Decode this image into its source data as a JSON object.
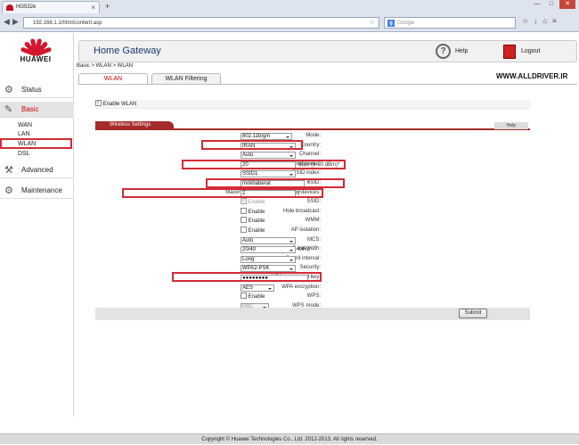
{
  "browser": {
    "tab_title": "HG532e",
    "tab_close": "×",
    "new_tab": "+",
    "url": "192.168.1.1/html/content.asp",
    "search_placeholder": "Google",
    "search_engine_letter": "g",
    "url_star": "☆",
    "back_arrow": "◀",
    "forward_arrow": "▶",
    "window_minimize": "—",
    "window_maximize": "□",
    "window_close": "✕"
  },
  "brand": {
    "logo_text": "HUAWEI"
  },
  "sidebar": {
    "items": [
      {
        "label": "Status",
        "icon": "status-icon"
      },
      {
        "label": "Basic",
        "icon": "wrench-icon",
        "active": true
      },
      {
        "label": "Advanced",
        "icon": "advanced-icon"
      },
      {
        "label": "Maintenance",
        "icon": "maintenance-icon"
      }
    ],
    "sub": [
      "WAN",
      "LAN",
      "WLAN",
      "DSL"
    ]
  },
  "header": {
    "title": "Home Gateway",
    "help": "Help",
    "logout": "Logout"
  },
  "breadcrumb": "Basic > WLAN > WLAN",
  "watermark": "WWW.ALLDRIVER.IR",
  "tabs": [
    {
      "label": "WLAN",
      "active": true
    },
    {
      "label": "WLAN Filtering",
      "active": false
    }
  ],
  "enable_wlan": {
    "label": "Enable WLAN",
    "checked": true
  },
  "section": {
    "title": "Wireless Settings",
    "help": "Help"
  },
  "fields": {
    "mode": {
      "label": "Mode:",
      "value": "802.11b/g/n"
    },
    "country": {
      "label": "Country:",
      "value": "IRAN"
    },
    "channel": {
      "label": "Channel:",
      "value": "Auto"
    },
    "tx_power": {
      "label": "Transmit power:",
      "value": "20",
      "hint": "dBm (1-20 dBm)*"
    },
    "ssid_index": {
      "label": "SSID index:",
      "value": "SSID1"
    },
    "ssid": {
      "label": "SSID:",
      "value": "mokhaberat",
      "required": "*"
    },
    "max_devices": {
      "label": "Maximum number of accessing devices:",
      "value": "2",
      "required": "*"
    },
    "ssid_enable": {
      "label": "SSID:",
      "text": "Enable",
      "checked": true
    },
    "hide_broadcast": {
      "label": "Hide broadcast:",
      "text": "Enable"
    },
    "wmm": {
      "label": "WMM:",
      "text": "Enable"
    },
    "ap_isolation": {
      "label": "AP isolation:",
      "text": "Enable"
    },
    "mcs": {
      "label": "MCS:",
      "value": "Auto"
    },
    "bandwidth": {
      "label": "Band width:",
      "value": "20/40",
      "unit": "MHZ"
    },
    "guard_interval": {
      "label": "Guard interval:",
      "value": "Long"
    },
    "security": {
      "label": "Security:",
      "value": "WPA2-PSK"
    },
    "wpa_key": {
      "label": "WPA pre-shared key:",
      "value": "●●●●●●●●",
      "required": "*"
    },
    "wpa_encryption": {
      "label": "WPA encryption:",
      "value": "AES"
    },
    "wps": {
      "label": "WPS:",
      "text": "Enable"
    },
    "wps_mode": {
      "label": "WPS mode:",
      "value": "PBC"
    }
  },
  "submit_label": "Submit",
  "footer": "Copyright © Huawei Technologies Co., Ltd. 2012-2013. All rights reserved.",
  "colors": {
    "brand_red": "#c8102e",
    "highlight": "#d32b36",
    "section_bar": "#a52a2a"
  }
}
